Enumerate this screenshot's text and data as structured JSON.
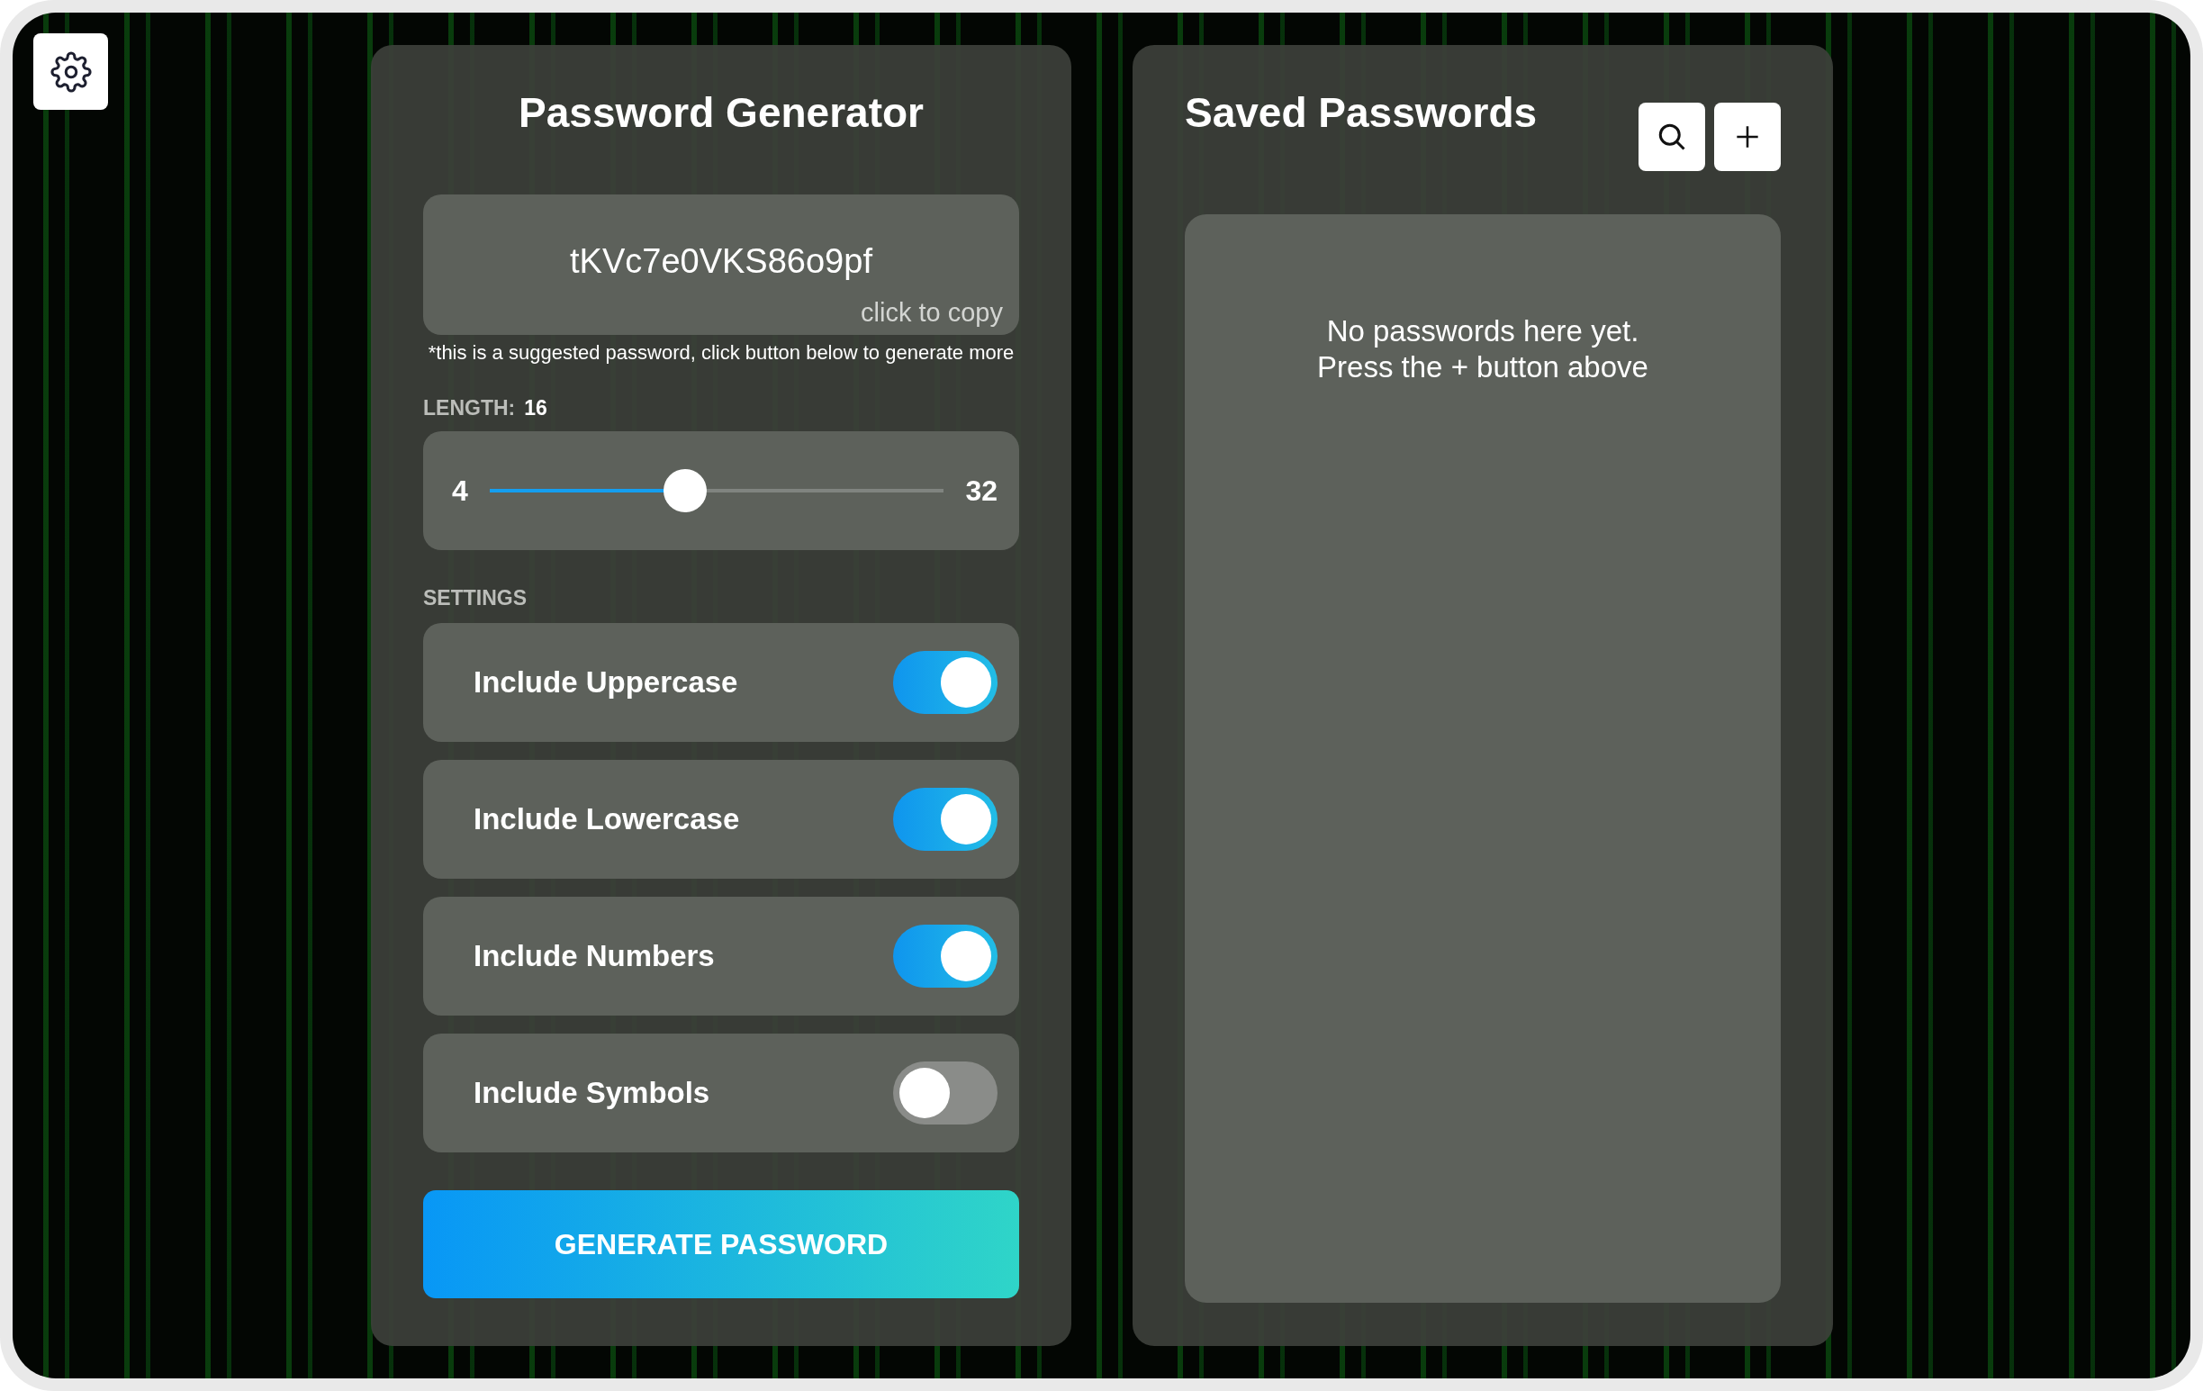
{
  "generator": {
    "title": "Password Generator",
    "password": "tKVc7e0VKS86o9pf",
    "copy_hint": "click to copy",
    "note": "*this is a suggested password, click button below to generate more",
    "length_label": "LENGTH:",
    "length_value": "16",
    "slider": {
      "min": "4",
      "max": "32",
      "level": 0.43
    },
    "settings_label": "SETTINGS",
    "settings": [
      {
        "label": "Include Uppercase",
        "on": true
      },
      {
        "label": "Include Lowercase",
        "on": true
      },
      {
        "label": "Include Numbers",
        "on": true
      },
      {
        "label": "Include Symbols",
        "on": false
      }
    ],
    "generate_button": "GENERATE PASSWORD"
  },
  "saved": {
    "title": "Saved Passwords",
    "empty_message": [
      "No passwords here yet.",
      "Press the + button above"
    ]
  }
}
